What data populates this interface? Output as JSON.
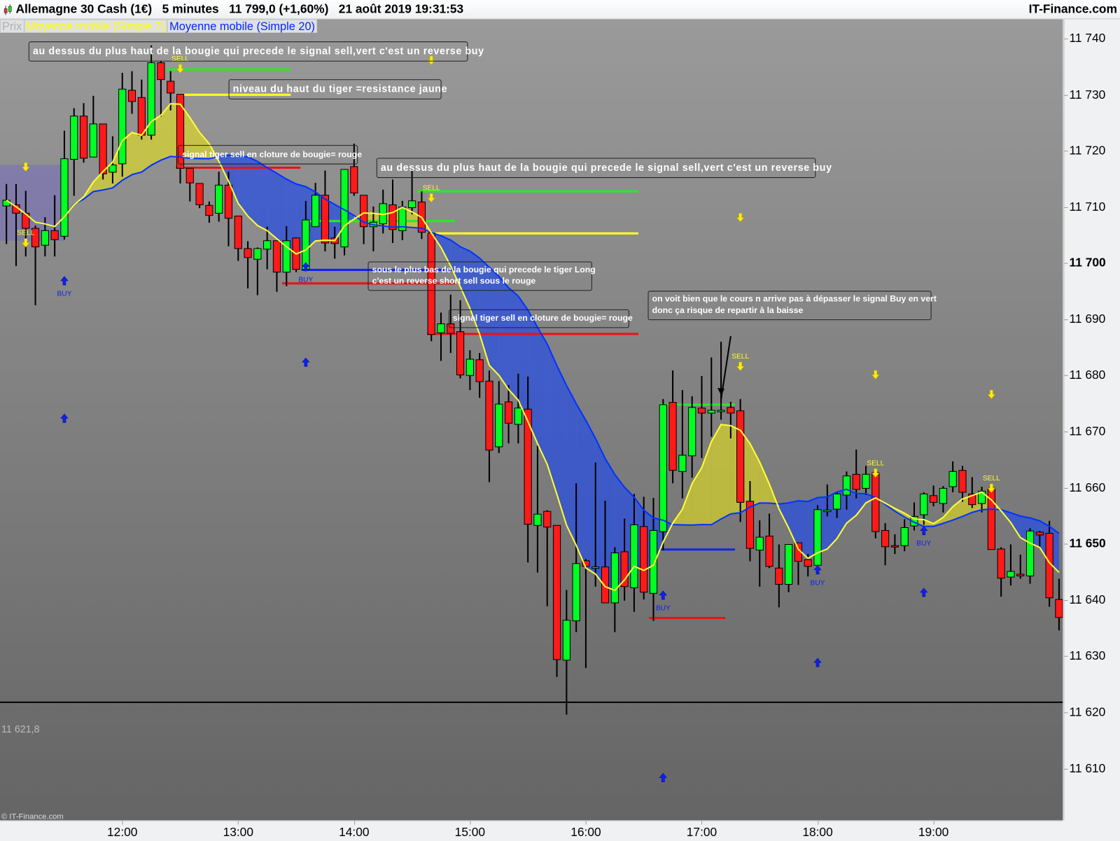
{
  "header": {
    "title": "Allemagne 30 Cash (1€)   5 minutes   11 799,0 (+1,60%)   21 août 2019 19:31:53",
    "brand": "IT-Finance.com",
    "logo_icon": "candlestick-icon"
  },
  "legend": [
    {
      "label": "Prix",
      "color": "#b0b0b0"
    },
    {
      "label": "Moyenne mobile (Simple 7)",
      "color": "#ffff00"
    },
    {
      "label": "Moyenne mobile (Simple 20)",
      "color": "#0026ff"
    }
  ],
  "footer": {
    "copyright": "© IT-Finance.com"
  },
  "chart_data": {
    "type": "candlestick",
    "instrument": "Allemagne 30 Cash (1€)",
    "interval": "5 minutes",
    "colors": {
      "up": "#00ff22",
      "down": "#ff1a1a",
      "ma7": "#ffff33",
      "ma20": "#0033ff",
      "fill_up": "#e8e21a",
      "fill_down": "#2a4fe0"
    },
    "ylim": [
      11604,
      11746
    ],
    "y_ticks": [
      {
        "value": 11740,
        "label": "11 740"
      },
      {
        "value": 11730,
        "label": "11 730"
      },
      {
        "value": 11720,
        "label": "11 720"
      },
      {
        "value": 11710,
        "label": "11 710"
      },
      {
        "value": 11700,
        "label": "11 700",
        "bold": true
      },
      {
        "value": 11690,
        "label": "11 690"
      },
      {
        "value": 11680,
        "label": "11 680"
      },
      {
        "value": 11670,
        "label": "11 670"
      },
      {
        "value": 11660,
        "label": "11 660"
      },
      {
        "value": 11650,
        "label": "11 650",
        "bold": true
      },
      {
        "value": 11640,
        "label": "11 640"
      },
      {
        "value": 11630,
        "label": "11 630"
      },
      {
        "value": 11620,
        "label": "11 620"
      },
      {
        "value": 11610,
        "label": "11 610"
      }
    ],
    "x_ticks": [
      {
        "label": "12:00",
        "candle": 13
      },
      {
        "label": "13:00",
        "candle": 25
      },
      {
        "label": "14:00",
        "candle": 37
      },
      {
        "label": "15:00",
        "candle": 49
      },
      {
        "label": "16:00",
        "candle": 61
      },
      {
        "label": "17:00",
        "candle": 73
      },
      {
        "label": "18:00",
        "candle": 85
      },
      {
        "label": "19:00",
        "candle": 97
      }
    ],
    "candles_ohlc": [
      [
        11710.2,
        11714.1,
        11703.4,
        11711.2
      ],
      [
        11710.4,
        11714.1,
        11699.5,
        11708.9
      ],
      [
        11708.9,
        11712.9,
        11701.2,
        11706.2
      ],
      [
        11706.2,
        11706.7,
        11692.5,
        11702.9
      ],
      [
        11703.2,
        11708.2,
        11701.2,
        11705.8
      ],
      [
        11705.8,
        11712.1,
        11701.2,
        11704.2
      ],
      [
        11704.8,
        11723.6,
        11704.2,
        11718.6
      ],
      [
        11718.5,
        11727.6,
        11712.0,
        11726.2
      ],
      [
        11726.2,
        11728.5,
        11717.9,
        11718.7
      ],
      [
        11718.9,
        11729.8,
        11718.9,
        11724.8
      ],
      [
        11724.8,
        11724.8,
        11714.9,
        11715.9
      ],
      [
        11716.2,
        11722.6,
        11714.2,
        11717.5
      ],
      [
        11717.7,
        11733.9,
        11715.4,
        11731.0
      ],
      [
        11730.8,
        11734.2,
        11726.6,
        11728.8
      ],
      [
        11729.5,
        11732.7,
        11722.0,
        11722.8
      ],
      [
        11722.8,
        11738.8,
        11722.0,
        11735.7
      ],
      [
        11735.7,
        11736.0,
        11726.1,
        11732.7
      ],
      [
        11732.4,
        11734.2,
        11727.2,
        11730.3
      ],
      [
        11730.1,
        11730.1,
        11714.2,
        11716.9
      ],
      [
        11716.9,
        11716.9,
        11711.0,
        11714.3
      ],
      [
        11714.2,
        11714.2,
        11709.8,
        11710.4
      ],
      [
        11710.3,
        11711.0,
        11707.2,
        11708.5
      ],
      [
        11708.9,
        11716.3,
        11707.4,
        11713.9
      ],
      [
        11713.9,
        11716.3,
        11703.0,
        11708.0
      ],
      [
        11708.4,
        11708.4,
        11700.4,
        11702.6
      ],
      [
        11702.6,
        11703.9,
        11695.5,
        11701.0
      ],
      [
        11700.7,
        11702.8,
        11694.3,
        11702.6
      ],
      [
        11702.5,
        11706.5,
        11698.9,
        11704.0
      ],
      [
        11704.0,
        11704.0,
        11694.9,
        11698.4
      ],
      [
        11698.4,
        11706.6,
        11695.9,
        11704.0
      ],
      [
        11704.5,
        11704.6,
        11698.4,
        11698.9
      ],
      [
        11698.9,
        11711.1,
        11698.9,
        11707.7
      ],
      [
        11706.5,
        11714.3,
        11706.5,
        11712.1
      ],
      [
        11712.1,
        11716.5,
        11702.1,
        11703.6
      ],
      [
        11704.5,
        11706.5,
        11700.8,
        11703.5
      ],
      [
        11702.9,
        11716.7,
        11701.4,
        11716.7
      ],
      [
        11717.2,
        11721.3,
        11712.0,
        11712.5
      ],
      [
        11712.1,
        11712.1,
        11703.4,
        11706.5
      ],
      [
        11706.5,
        11710.1,
        11702.1,
        11707.3
      ],
      [
        11707.0,
        11713.1,
        11705.3,
        11710.6
      ],
      [
        11710.4,
        11714.9,
        11703.6,
        11706.0
      ],
      [
        11705.8,
        11711.1,
        11704.1,
        11710.0
      ],
      [
        11709.9,
        11716.7,
        11708.7,
        11711.1
      ],
      [
        11710.9,
        11712.8,
        11704.3,
        11705.5
      ],
      [
        11705.4,
        11705.4,
        11686.1,
        11687.3
      ],
      [
        11687.6,
        11691.2,
        11682.6,
        11689.2
      ],
      [
        11689.2,
        11694.4,
        11684.0,
        11687.5
      ],
      [
        11687.8,
        11693.4,
        11679.5,
        11680.1
      ],
      [
        11680.0,
        11684.5,
        11677.4,
        11682.9
      ],
      [
        11682.8,
        11684.0,
        11676.0,
        11678.9
      ],
      [
        11679.0,
        11680.9,
        11661.0,
        11666.7
      ],
      [
        11667.3,
        11679.0,
        11666.2,
        11674.9
      ],
      [
        11675.3,
        11678.3,
        11667.9,
        11671.5
      ],
      [
        11671.3,
        11680.3,
        11667.9,
        11674.2
      ],
      [
        11674.0,
        11679.8,
        11646.7,
        11653.5
      ],
      [
        11653.3,
        11667.5,
        11644.9,
        11655.3
      ],
      [
        11655.8,
        11656.0,
        11638.9,
        11653.0
      ],
      [
        11653.3,
        11653.3,
        11626.3,
        11629.4
      ],
      [
        11629.3,
        11641.8,
        11619.6,
        11636.4
      ],
      [
        11636.3,
        11660.8,
        11634.3,
        11646.5
      ],
      [
        11647.0,
        11647.3,
        11627.9,
        11646.0
      ],
      [
        11645.7,
        11664.5,
        11642.4,
        11645.9
      ],
      [
        11645.9,
        11657.7,
        11639.5,
        11639.5
      ],
      [
        11639.5,
        11649.4,
        11634.3,
        11648.4
      ],
      [
        11648.6,
        11654.5,
        11639.9,
        11642.4
      ],
      [
        11642.2,
        11658.9,
        11637.9,
        11653.4
      ],
      [
        11653.1,
        11658.4,
        11640.1,
        11641.4
      ],
      [
        11641.2,
        11658.2,
        11636.3,
        11652.4
      ],
      [
        11652.2,
        11675.8,
        11648.9,
        11674.8
      ],
      [
        11675.2,
        11680.9,
        11660.8,
        11663.1
      ],
      [
        11662.9,
        11677.4,
        11658.1,
        11665.8
      ],
      [
        11665.7,
        11676.3,
        11661.8,
        11674.3
      ],
      [
        11674.2,
        11679.9,
        11665.3,
        11673.3
      ],
      [
        11673.3,
        11683.2,
        11669.1,
        11673.8
      ],
      [
        11673.8,
        11686.0,
        11672.1,
        11673.8
      ],
      [
        11674.3,
        11675.3,
        11668.8,
        11673.3
      ],
      [
        11673.7,
        11675.8,
        11653.9,
        11657.4
      ],
      [
        11657.6,
        11661.2,
        11646.9,
        11649.2
      ],
      [
        11648.9,
        11654.2,
        11642.4,
        11651.2
      ],
      [
        11651.4,
        11655.4,
        11645.7,
        11646.0
      ],
      [
        11645.7,
        11649.9,
        11638.7,
        11642.8
      ],
      [
        11642.8,
        11649.9,
        11641.4,
        11649.9
      ],
      [
        11650.2,
        11650.2,
        11642.7,
        11646.9
      ],
      [
        11647.2,
        11648.2,
        11644.2,
        11646.0
      ],
      [
        11646.2,
        11656.9,
        11646.2,
        11656.1
      ],
      [
        11656.0,
        11660.6,
        11654.9,
        11656.0
      ],
      [
        11656.2,
        11659.2,
        11654.6,
        11658.9
      ],
      [
        11658.7,
        11662.9,
        11656.1,
        11662.1
      ],
      [
        11662.4,
        11666.8,
        11658.1,
        11659.7
      ],
      [
        11659.9,
        11663.9,
        11658.7,
        11662.4
      ],
      [
        11662.7,
        11663.1,
        11651.0,
        11652.2
      ],
      [
        11652.4,
        11653.7,
        11646.2,
        11649.5
      ],
      [
        11649.7,
        11651.7,
        11648.2,
        11649.5
      ],
      [
        11649.7,
        11654.4,
        11648.7,
        11652.9
      ],
      [
        11653.2,
        11657.4,
        11652.4,
        11654.9
      ],
      [
        11655.2,
        11659.2,
        11653.4,
        11658.9
      ],
      [
        11658.6,
        11660.4,
        11656.7,
        11657.4
      ],
      [
        11657.2,
        11660.3,
        11655.6,
        11659.9
      ],
      [
        11660.2,
        11664.7,
        11659.2,
        11662.9
      ],
      [
        11663.1,
        11663.9,
        11657.5,
        11659.2
      ],
      [
        11658.9,
        11661.9,
        11656.4,
        11657.0
      ],
      [
        11657.2,
        11660.2,
        11655.6,
        11659.4
      ],
      [
        11659.9,
        11660.4,
        11649.0,
        11649.0
      ],
      [
        11649.1,
        11649.4,
        11640.6,
        11643.9
      ],
      [
        11644.1,
        11649.9,
        11642.6,
        11645.1
      ],
      [
        11644.6,
        11648.1,
        11643.8,
        11644.3
      ],
      [
        11644.3,
        11652.8,
        11642.9,
        11652.3
      ],
      [
        11652.1,
        11652.3,
        11649.5,
        11651.6
      ],
      [
        11651.9,
        11654.1,
        11638.8,
        11640.4
      ],
      [
        11640.1,
        11643.8,
        11634.6,
        11636.9
      ]
    ],
    "moving_averages": [
      {
        "name": "Moyenne mobile (Simple 7)",
        "period": 7
      },
      {
        "name": "Moyenne mobile (Simple 20)",
        "period": 20
      }
    ],
    "signals": [
      {
        "type": "sell",
        "candle": 3,
        "price": 11717.0,
        "label": ""
      },
      {
        "type": "sell",
        "candle": 3,
        "price": 11703.5,
        "label": "SELL"
      },
      {
        "type": "sell",
        "candle": 19,
        "price": 11734.5,
        "label": "SELL"
      },
      {
        "type": "sell",
        "candle": 45,
        "price": 11736.0,
        "label": ""
      },
      {
        "type": "sell",
        "candle": 45,
        "price": 11711.5,
        "label": "SELL"
      },
      {
        "type": "sell",
        "candle": 77,
        "price": 11708.0,
        "label": ""
      },
      {
        "type": "sell",
        "candle": 77,
        "price": 11681.5,
        "label": "SELL"
      },
      {
        "type": "sell",
        "candle": 91,
        "price": 11680.0,
        "label": ""
      },
      {
        "type": "sell",
        "candle": 91,
        "price": 11662.5,
        "label": "SELL"
      },
      {
        "type": "sell",
        "candle": 103,
        "price": 11676.5,
        "label": ""
      },
      {
        "type": "sell",
        "candle": 103,
        "price": 11659.8,
        "label": "SELL"
      },
      {
        "type": "buy",
        "candle": 7,
        "price": 11697.0,
        "label": "BUY"
      },
      {
        "type": "buy",
        "candle": 7,
        "price": 11672.5,
        "label": ""
      },
      {
        "type": "buy",
        "candle": 32,
        "price": 11699.5,
        "label": "BUY"
      },
      {
        "type": "buy",
        "candle": 32,
        "price": 11682.5,
        "label": ""
      },
      {
        "type": "buy",
        "candle": 69,
        "price": 11641.0,
        "label": "BUY"
      },
      {
        "type": "buy",
        "candle": 69,
        "price": 11608.5,
        "label": ""
      },
      {
        "type": "buy",
        "candle": 85,
        "price": 11645.5,
        "label": "BUY"
      },
      {
        "type": "buy",
        "candle": 85,
        "price": 11629.0,
        "label": ""
      },
      {
        "type": "buy",
        "candle": 96,
        "price": 11652.5,
        "label": "BUY"
      },
      {
        "type": "buy",
        "candle": 96,
        "price": 11641.5,
        "label": ""
      }
    ],
    "levels": [
      {
        "price": 11734.5,
        "from": 18,
        "to": 30,
        "color": "#22ee22"
      },
      {
        "price": 11730.0,
        "from": 19,
        "to": 30,
        "color": "#ffff22"
      },
      {
        "price": 11717.0,
        "from": 19,
        "to": 31,
        "color": "#ee1111"
      },
      {
        "price": 11712.8,
        "from": 44,
        "to": 66,
        "color": "#22ee22"
      },
      {
        "price": 11707.5,
        "from": 32,
        "to": 47,
        "color": "#22ee22"
      },
      {
        "price": 11705.3,
        "from": 45,
        "to": 66,
        "color": "#ffff22"
      },
      {
        "price": 11698.8,
        "from": 32,
        "to": 47,
        "color": "#1122ee"
      },
      {
        "price": 11696.4,
        "from": 30,
        "to": 47,
        "color": "#ee1111"
      },
      {
        "price": 11687.4,
        "from": 45,
        "to": 66,
        "color": "#ee1111"
      },
      {
        "price": 11674.8,
        "from": 69,
        "to": 76,
        "color": "#22ee22"
      },
      {
        "price": 11649.0,
        "from": 69,
        "to": 76,
        "color": "#1122ee"
      },
      {
        "price": 11636.8,
        "from": 68,
        "to": 75,
        "color": "#ee1111"
      }
    ],
    "low_line": {
      "price": 11621.8,
      "label": "11 621,8",
      "color": "#000000"
    },
    "arrow": {
      "from_candle": 76,
      "from_price": 11687.0,
      "to_candle": 75,
      "to_price": 11676.5
    },
    "annotations": [
      {
        "id": "note-1",
        "lines": [
          "au dessus du plus haut de la bougie qui precede le signal sell,vert c'est un reverse buy"
        ]
      },
      {
        "id": "note-2",
        "lines": [
          "niveau du haut du tiger =resistance jaune"
        ]
      },
      {
        "id": "note-3",
        "lines": [
          "signal tiger sell en cloture de bougie= rouge"
        ]
      },
      {
        "id": "note-4",
        "lines": [
          "au dessus du plus haut de la bougie qui precede le signal sell,vert c'est un reverse buy"
        ]
      },
      {
        "id": "note-5",
        "lines": [
          "sous le plus bas de la bougie qui precede le tiger Long",
          "c'est un reverse short sell sous le rouge"
        ]
      },
      {
        "id": "note-6",
        "lines": [
          "signal tiger sell en cloture de bougie= rouge"
        ]
      },
      {
        "id": "note-7",
        "lines": [
          "on voit bien que le cours n arrive pas à dépasser le signal Buy en vert",
          "donc ça risque de repartir à la baisse"
        ]
      }
    ]
  }
}
